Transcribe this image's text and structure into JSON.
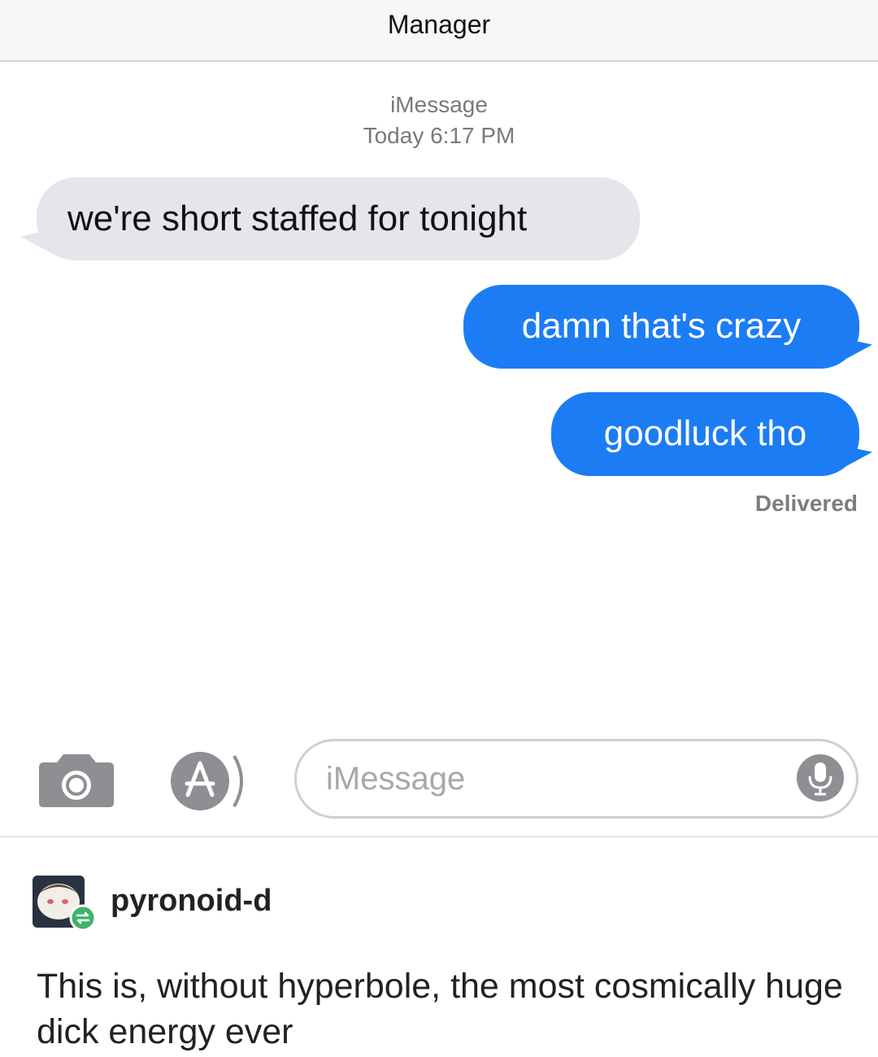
{
  "header": {
    "title": "Manager"
  },
  "thread_meta": {
    "service": "iMessage",
    "timestamp": "Today 6:17 PM"
  },
  "messages": [
    {
      "direction": "incoming",
      "text": "we're short staffed for tonight"
    },
    {
      "direction": "outgoing",
      "text": "damn that's crazy"
    },
    {
      "direction": "outgoing",
      "text": "goodluck tho"
    }
  ],
  "delivery_status": "Delivered",
  "input_bar": {
    "placeholder": "iMessage",
    "icons": [
      "camera-icon",
      "app-store-icon",
      "microphone-icon"
    ]
  },
  "post": {
    "username": "pyronoid-d",
    "text": "This is, without hyperbole, the most cosmically huge dick energy ever"
  },
  "colors": {
    "outgoing_bubble": "#1c7cf4",
    "incoming_bubble": "#e6e5eb",
    "icon_gray": "#8e8e93",
    "reblog_green": "#3fb36b"
  }
}
